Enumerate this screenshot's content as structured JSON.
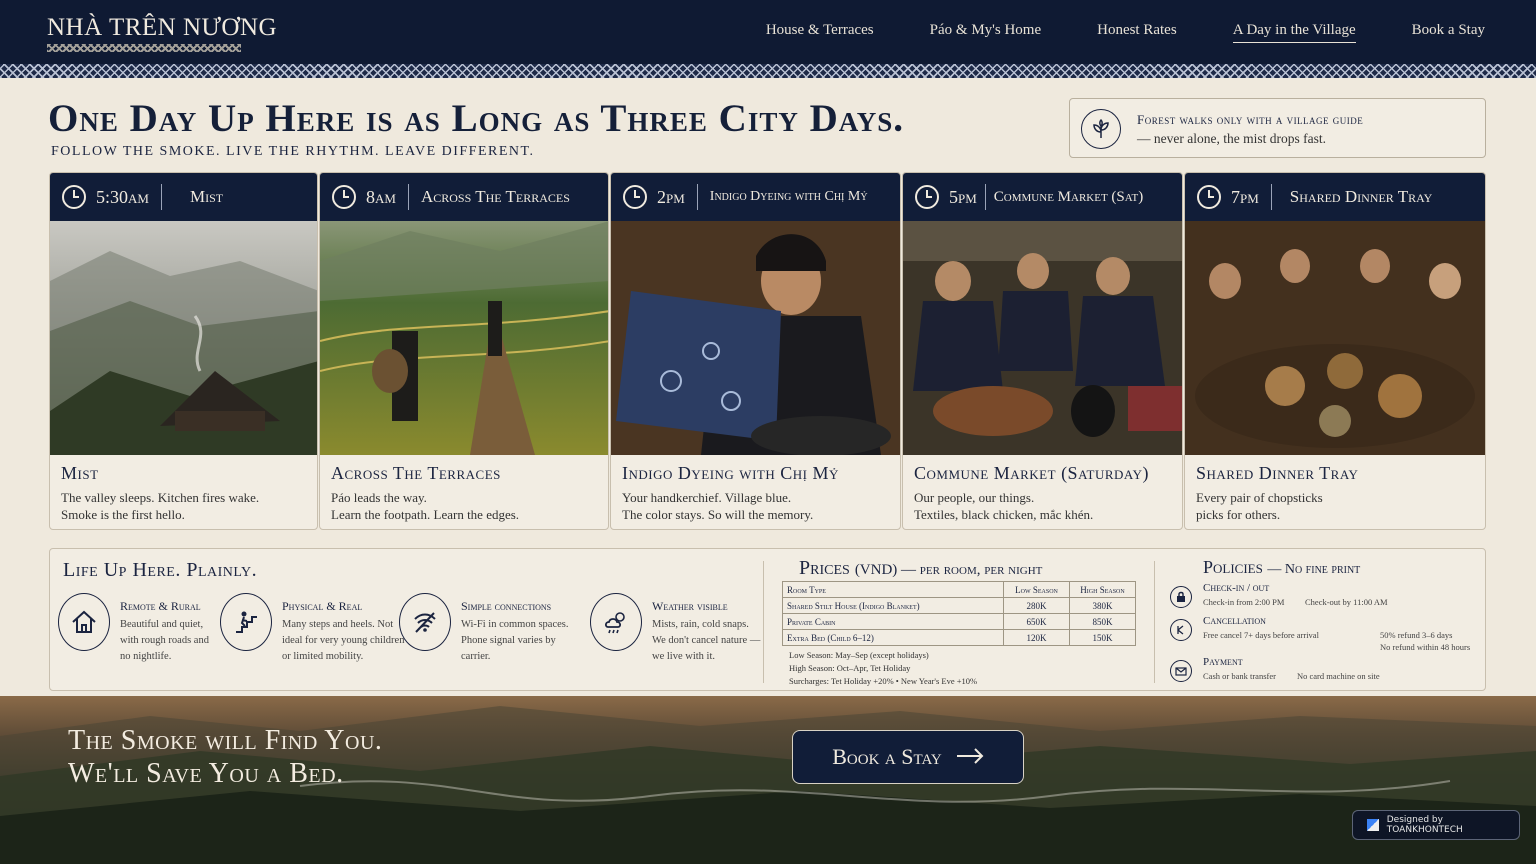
{
  "brand": {
    "name": "NHÀ TRÊN NƯƠNG"
  },
  "nav": {
    "items": [
      {
        "label": "House & Terraces"
      },
      {
        "label": "Páo & My's Home"
      },
      {
        "label": "Honest Rates"
      },
      {
        "label": "A Day in the Village",
        "active": true
      },
      {
        "label": "Book a Stay"
      }
    ]
  },
  "header": {
    "title": "One Day Up Here is as Long as Three City Days.",
    "subtitle": "FOLLOW THE SMOKE. LIVE THE RHYTHM. LEAVE DIFFERENT."
  },
  "notice": {
    "icon": "leaf-icon",
    "title": "Forest walks only with a village guide",
    "text": "— never alone, the mist drops fast."
  },
  "timeline": [
    {
      "time": "5:30am",
      "heading": "Mist",
      "title": "Mist",
      "line1": "The valley sleeps. Kitchen fires wake.",
      "line2": "Smoke is the first hello."
    },
    {
      "time": "8am",
      "heading": "Across The Terraces",
      "title": "Across The Terraces",
      "line1": "Páo leads the way.",
      "line2": "Learn the footpath. Learn the edges."
    },
    {
      "time": "2pm",
      "heading": "Indigo Dyeing with Chị Mỷ",
      "title": "Indigo Dyeing with Chị Mỷ",
      "line1": "Your handkerchief. Village blue.",
      "line2": "The color stays. So will the memory."
    },
    {
      "time": "5pm",
      "heading": "Commune Market (Sat)",
      "title": "Commune Market (Saturday)",
      "line1": "Our people, our things.",
      "line2": "Textiles, black chicken, mắc khén."
    },
    {
      "time": "7pm",
      "heading": "Shared Dinner Tray",
      "title": "Shared Dinner Tray",
      "line1": "Every pair of chopsticks",
      "line2": "picks for others."
    }
  ],
  "life": {
    "title": "Life Up Here. Plainly.",
    "features": [
      {
        "icon": "house-icon",
        "title": "Remote & Rural",
        "text": "Beautiful and quiet, with rough roads and no nightlife."
      },
      {
        "icon": "stairs-icon",
        "title": "Physical & Real",
        "text": "Many steps and heels. Not ideal for very young children or limited mobility."
      },
      {
        "icon": "wifi-off-icon",
        "title": "Simple connections",
        "text": "Wi-Fi in common spaces. Phone signal varies by carrier."
      },
      {
        "icon": "weather-icon",
        "title": "Weather visible",
        "text": "Mists, rain, cold snaps. We don't cancel nature — we live with it."
      }
    ]
  },
  "prices": {
    "title": "Prices",
    "unit": "(VND) — per room, per night",
    "columns": [
      "Room Type",
      "Low Season",
      "High Season"
    ],
    "rows": [
      [
        "Shared Stilt House (Indigo Blanket)",
        "280K",
        "380K"
      ],
      [
        "Private Cabin",
        "650K",
        "850K"
      ],
      [
        "Extra Bed (Child 6–12)",
        "120K",
        "150K"
      ]
    ],
    "notes": [
      "Low Season: May–Sep (except holidays)",
      "High Season: Oct–Apr, Tet Holiday",
      "Surcharges: Tet Holiday +20% • New Year's Eve +10%"
    ]
  },
  "policies": {
    "title": "Policies",
    "subtitle": "— No fine print",
    "items": [
      {
        "icon": "lock-icon",
        "name": "Check-in / out",
        "a": "Check-in from 2:00 PM",
        "b": "Check-out by 11:00 AM"
      },
      {
        "icon": "cancel-icon",
        "name": "Cancellation",
        "a": "Free cancel 7+ days before arrival",
        "b": "50% refund 3–6 days",
        "c": "No refund within 48 hours"
      },
      {
        "icon": "payment-icon",
        "name": "Payment",
        "a": "Cash or bank transfer",
        "b": "No card machine on site"
      }
    ]
  },
  "footer": {
    "line1": "The Smoke will Find You.",
    "line2": "We'll Save You a Bed.",
    "button": "Book a Stay",
    "credit": "Designed by TOANKHONTECH"
  }
}
